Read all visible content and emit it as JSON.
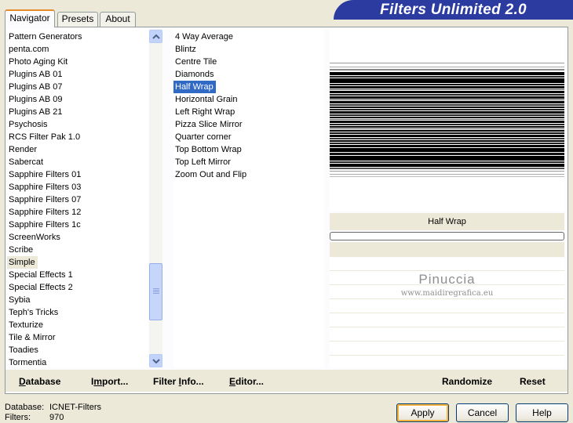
{
  "tabs": [
    {
      "label": "Navigator",
      "active": true
    },
    {
      "label": "Presets",
      "active": false
    },
    {
      "label": "About",
      "active": false
    }
  ],
  "title": "Filters Unlimited 2.0",
  "categories": [
    "Pattern Generators",
    "penta.com",
    "Photo Aging Kit",
    "Plugins AB 01",
    "Plugins AB 07",
    "Plugins AB 09",
    "Plugins AB 21",
    "Psychosis",
    "RCS Filter Pak 1.0",
    "Render",
    "Sabercat",
    "Sapphire Filters 01",
    "Sapphire Filters 03",
    "Sapphire Filters 07",
    "Sapphire Filters 12",
    "Sapphire Filters 1c",
    "ScreenWorks",
    "Scribe",
    "Simple",
    "Special Effects 1",
    "Special Effects 2",
    "Sybia",
    "Teph's Tricks",
    "Texturize",
    "Tile & Mirror",
    "Toadies",
    "Tormentia"
  ],
  "selected_category": "Simple",
  "filters": [
    "4 Way Average",
    "Blintz",
    "Centre Tile",
    "Diamonds",
    "Half Wrap",
    "Horizontal Grain",
    "Left Right Wrap",
    "Pizza Slice Mirror",
    "Quarter corner",
    "Top Bottom Wrap",
    "Top Left Mirror",
    "Zoom Out and Flip"
  ],
  "selected_filter": "Half Wrap",
  "filter_name": "Half Wrap",
  "watermark": {
    "title": "Pinuccia",
    "url": "www.maidiregrafica.eu"
  },
  "toolbar": {
    "database": {
      "u": "D",
      "rest": "atabase"
    },
    "import": {
      "pre": "I",
      "u": "m",
      "rest": "port..."
    },
    "filter_info": {
      "pre": "Filter ",
      "u": "I",
      "rest": "nfo..."
    },
    "editor": {
      "u": "E",
      "rest": "ditor..."
    },
    "randomize": "Randomize",
    "reset": "Reset"
  },
  "status": {
    "database_label": "Database:",
    "database_value": "ICNET-Filters",
    "filters_label": "Filters:",
    "filters_value": "970"
  },
  "buttons": {
    "apply": "Apply",
    "cancel": "Cancel",
    "help": "Help"
  },
  "colors": {
    "accent": "#316ac5",
    "title_bg": "#2b3ba0",
    "dialog_bg": "#ece9d8"
  }
}
